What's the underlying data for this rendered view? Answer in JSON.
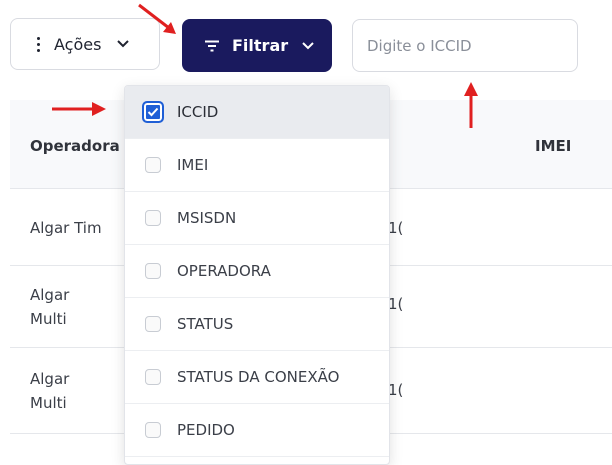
{
  "toolbar": {
    "actions_label": "Ações",
    "filter_label": "Filtrar",
    "search_placeholder": "Digite o ICCID"
  },
  "table": {
    "headers": {
      "operadora": "Operadora",
      "imei": "IMEI"
    },
    "rows": [
      {
        "operadora": "Algar Tim",
        "fragment": "1("
      },
      {
        "operadora": "Algar\nMulti",
        "fragment": "1("
      },
      {
        "operadora": "Algar\nMulti",
        "fragment": "1("
      }
    ]
  },
  "filter_menu": {
    "options": [
      {
        "label": "ICCID",
        "checked": true
      },
      {
        "label": "IMEI",
        "checked": false
      },
      {
        "label": "MSISDN",
        "checked": false
      },
      {
        "label": "OPERADORA",
        "checked": false
      },
      {
        "label": "STATUS",
        "checked": false
      },
      {
        "label": "STATUS DA CONEXÃO",
        "checked": false
      },
      {
        "label": "PEDIDO",
        "checked": false
      }
    ]
  },
  "colors": {
    "filter_button_bg": "#1a1a5e",
    "checkbox_checked": "#1f5fd6",
    "annotation_arrow": "#e02020"
  },
  "icons": {
    "actions": "kebab-vertical-icon",
    "filter": "filter-lines-icon",
    "dropdown": "chevron-down-icon",
    "checked": "checkmark-icon"
  }
}
